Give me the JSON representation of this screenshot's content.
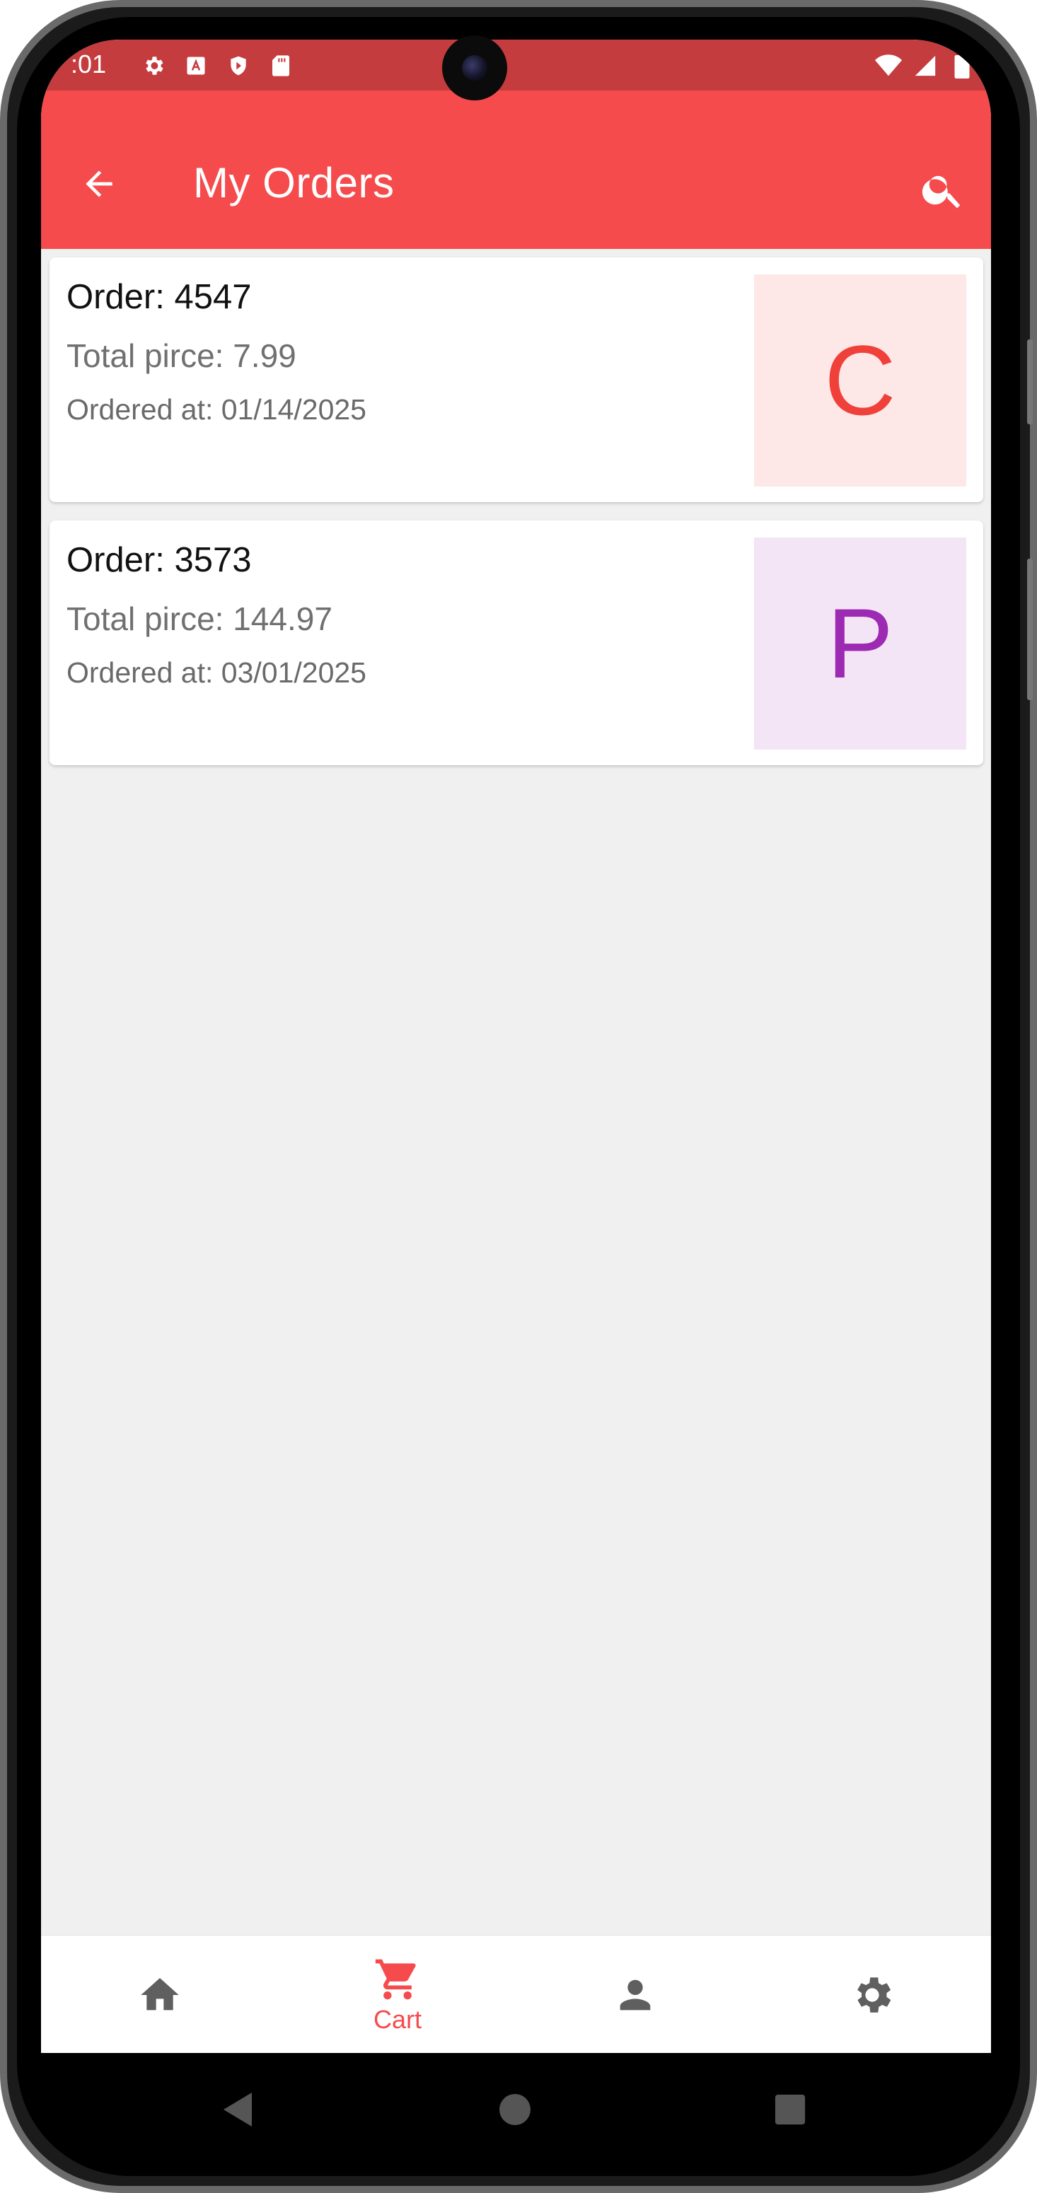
{
  "status_bar": {
    "time": ":01",
    "color": "#c53c3f"
  },
  "app_bar": {
    "title": "My Orders",
    "color": "#f54b4d",
    "back_icon": "arrow-back-icon",
    "search_icon": "search-icon"
  },
  "orders": [
    {
      "title": "Order: 4547",
      "total": "Total pirce: 7.99",
      "date": "Ordered at: 01/14/2025",
      "initial": "C",
      "thumb_bg": "#fde8e7",
      "thumb_fg": "#f0403a"
    },
    {
      "title": "Order: 3573",
      "total": "Total pirce: 144.97",
      "date": "Ordered at: 03/01/2025",
      "initial": "P",
      "thumb_bg": "#f3e5f5",
      "thumb_fg": "#9c2ab2"
    }
  ],
  "bottom_nav": {
    "items": [
      {
        "icon": "home-icon",
        "label": "",
        "active": false
      },
      {
        "icon": "cart-icon",
        "label": "Cart",
        "active": true
      },
      {
        "icon": "person-icon",
        "label": "",
        "active": false
      },
      {
        "icon": "settings-icon",
        "label": "",
        "active": false
      }
    ],
    "active_color": "#f54b4d",
    "inactive_color": "#5f5f5f"
  },
  "system_nav": {
    "back_icon": "triangle-back-icon",
    "home_icon": "circle-home-icon",
    "recents_icon": "square-recents-icon"
  }
}
